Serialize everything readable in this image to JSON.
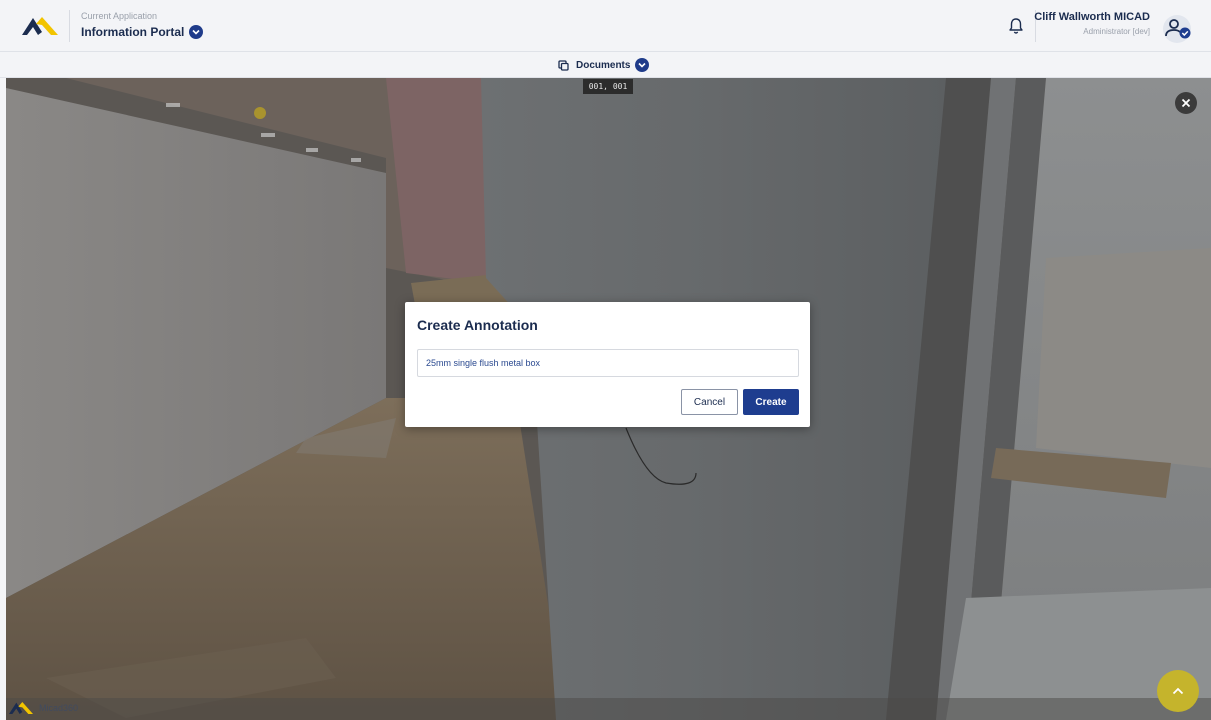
{
  "header": {
    "app_caption": "Current Application",
    "app_name": "Information Portal",
    "user_name": "Cliff Wallworth MICAD",
    "user_role": "Administrator [dev]"
  },
  "docbar": {
    "label": "Documents"
  },
  "viewer": {
    "coordinates": "001, 001"
  },
  "modal": {
    "title": "Create Annotation",
    "input_value": "25mm single flush metal box",
    "cancel_label": "Cancel",
    "create_label": "Create"
  },
  "footer": {
    "watermark_text": "Micad360"
  },
  "icons": {
    "logo": "micad-logo-icon",
    "app_switch": "chevron-down-icon",
    "notifications": "bell-icon",
    "avatar": "user-check-icon",
    "documents": "copy-icon",
    "close": "close-icon",
    "scroll_top": "chevron-up-icon"
  },
  "colors": {
    "brand_navy": "#1b2c4f",
    "primary_button": "#1e3d8f",
    "fab": "#c5b42c",
    "logo_yellow": "#f2c400"
  }
}
